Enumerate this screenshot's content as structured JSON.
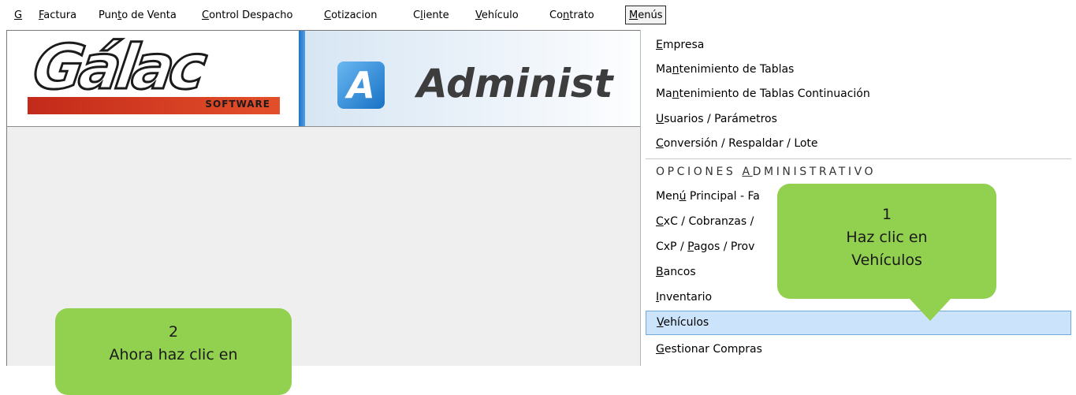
{
  "menubar": {
    "items": [
      {
        "key": "g",
        "label": "G"
      },
      {
        "key": "factura",
        "label": "Factura"
      },
      {
        "key": "punto_venta",
        "label": "Punto de Venta"
      },
      {
        "key": "control_despacho",
        "label": "Control Despacho"
      },
      {
        "key": "cotizacion",
        "label": "Cotizacion"
      },
      {
        "key": "cliente",
        "label": "Cliente"
      },
      {
        "key": "vehiculo",
        "label": "Vehículo"
      },
      {
        "key": "contrato",
        "label": "Contrato"
      },
      {
        "key": "menus",
        "label": "Menús",
        "active": true
      }
    ]
  },
  "banner": {
    "galac_logo": "Gálac",
    "galac_sub": "SOFTWARE",
    "a_logo": "A",
    "app_title_visible": "Administ"
  },
  "dropdown": {
    "items": [
      {
        "label": "Empresa"
      },
      {
        "label": "Mantenimiento de Tablas"
      },
      {
        "label": "Mantenimiento de Tablas Continuación"
      },
      {
        "label": "Usuarios / Parámetros"
      },
      {
        "label": "Conversión / Respaldar / Lote"
      },
      {
        "label": "OPCIONES ADMINISTRATIVO",
        "header": true
      },
      {
        "label": "Menú Principal - Fa"
      },
      {
        "label": "CxC / Cobranzas /"
      },
      {
        "label": "CxP / Pagos / Prov"
      },
      {
        "label": "Bancos"
      },
      {
        "label": "Inventario"
      },
      {
        "label": "Vehículos",
        "selected": true
      },
      {
        "label": "Gestionar Compras"
      }
    ]
  },
  "callouts": {
    "c1_number": "1",
    "c1_line1": "Haz clic en",
    "c1_line2": "Vehículos",
    "c2_number": "2",
    "c2_line1": "Ahora haz clic en"
  },
  "colors": {
    "callout_green": "#92d050",
    "selection_blue": "#cce4fb",
    "brand_blue": "#1e73c8",
    "galac_red": "#c32a1a"
  }
}
